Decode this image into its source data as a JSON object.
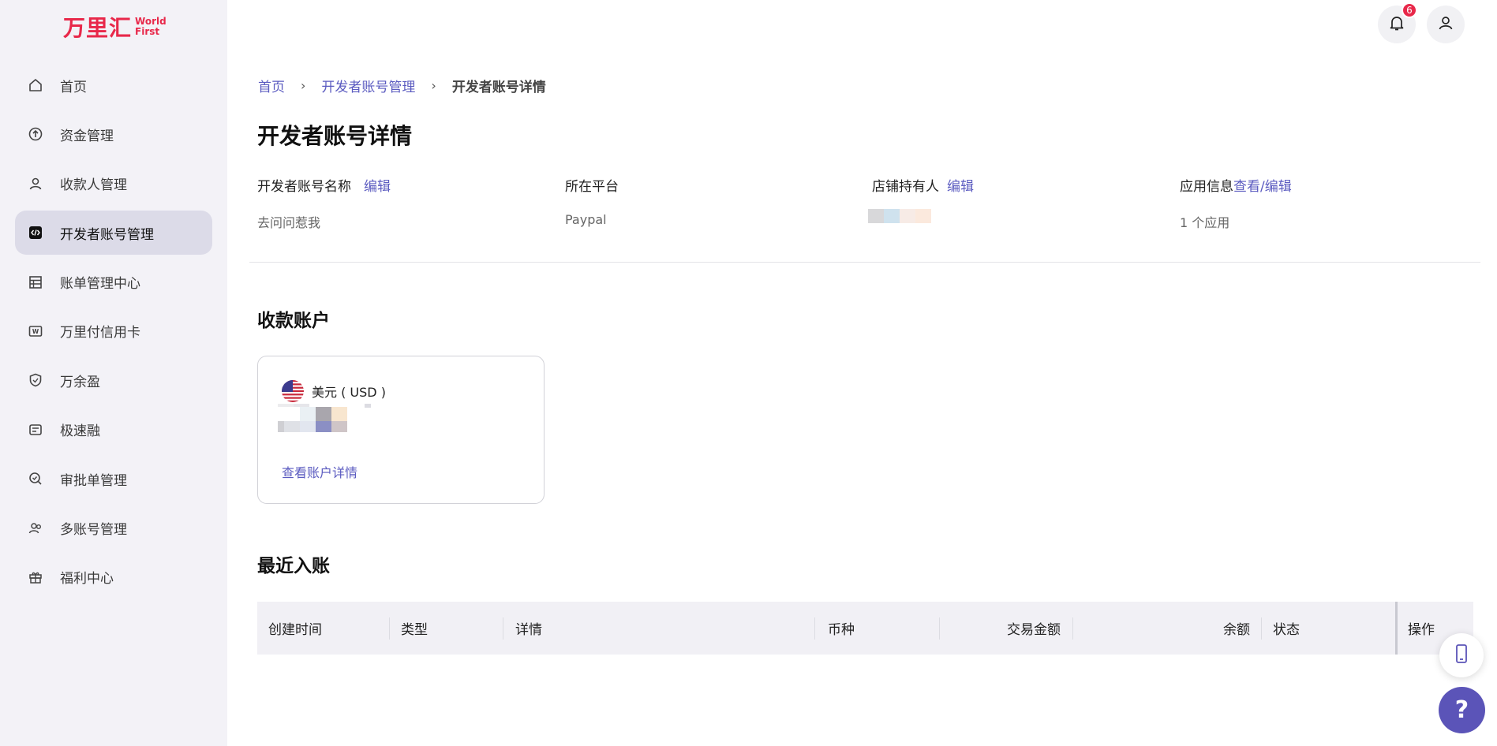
{
  "brand": {
    "name_cn": "万里汇",
    "name_en_1": "World",
    "name_en_2": "First"
  },
  "notifications": {
    "count": "6"
  },
  "sidebar": {
    "items": [
      {
        "label": "首页",
        "icon": "home-icon",
        "active": false
      },
      {
        "label": "资金管理",
        "icon": "fund-icon",
        "active": false
      },
      {
        "label": "收款人管理",
        "icon": "payee-icon",
        "active": false
      },
      {
        "label": "开发者账号管理",
        "icon": "code-icon",
        "active": true
      },
      {
        "label": "账单管理中心",
        "icon": "bill-icon",
        "active": false
      },
      {
        "label": "万里付信用卡",
        "icon": "card-icon",
        "active": false
      },
      {
        "label": "万余盈",
        "icon": "shield-icon",
        "active": false
      },
      {
        "label": "极速融",
        "icon": "finance-icon",
        "active": false
      },
      {
        "label": "审批单管理",
        "icon": "approval-icon",
        "active": false
      },
      {
        "label": "多账号管理",
        "icon": "multi-account-icon",
        "active": false
      },
      {
        "label": "福利中心",
        "icon": "gift-icon",
        "active": false
      }
    ]
  },
  "breadcrumb": {
    "home": "首页",
    "parent": "开发者账号管理",
    "current": "开发者账号详情"
  },
  "page": {
    "title": "开发者账号详情"
  },
  "info": {
    "name_label": "开发者账号名称",
    "name_edit": "编辑",
    "name_value": "去问问惹我",
    "platform_label": "所在平台",
    "platform_value": "Paypal",
    "owner_label": "店铺持有人",
    "owner_edit": "编辑",
    "app_label": "应用信息",
    "app_link": "查看/编辑",
    "app_value": "1 个应用"
  },
  "receiving": {
    "title": "收款账户",
    "currency": "美元 ( USD )",
    "detail_link": "查看账户详情"
  },
  "recent": {
    "title": "最近入账",
    "columns": [
      "创建时间",
      "类型",
      "详情",
      "币种",
      "交易金额",
      "余额",
      "状态",
      "操作"
    ]
  },
  "colors": {
    "accent": "#5b5bc0",
    "brand": "#e8284a",
    "sidebar_bg": "#f3f2f7",
    "help_button": "#5b54b8"
  }
}
